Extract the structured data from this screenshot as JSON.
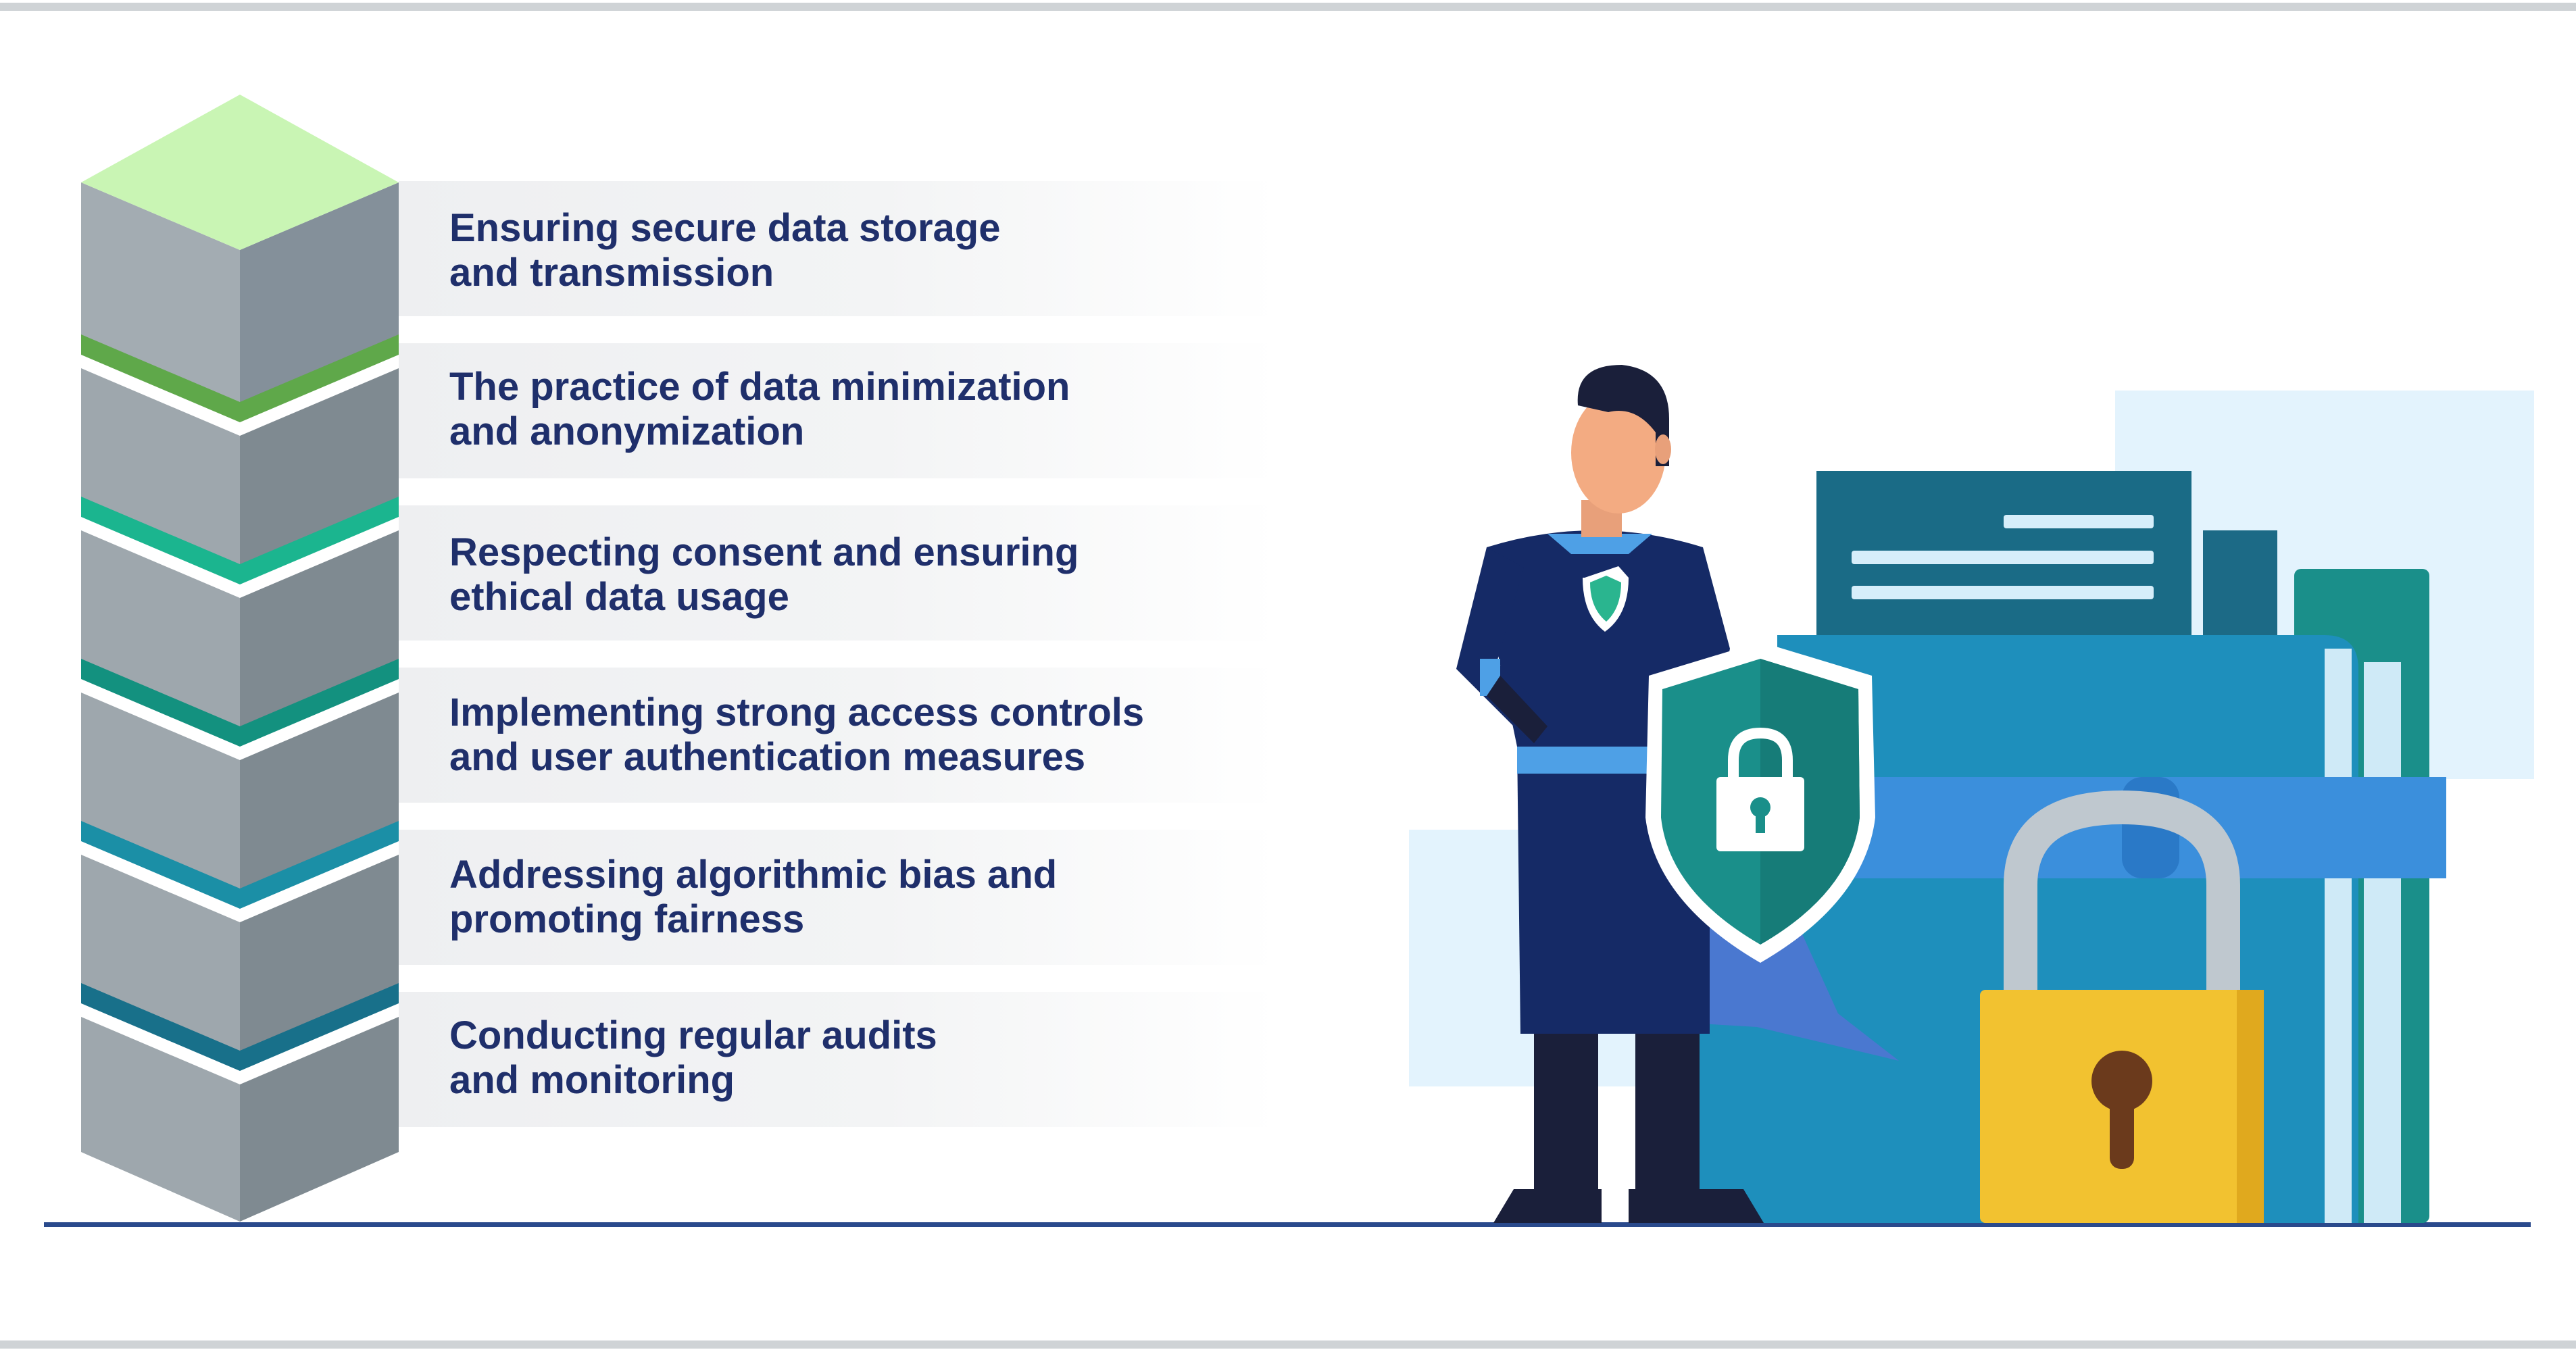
{
  "practices": [
    {
      "line1": "Ensuring secure data storage",
      "line2": "and transmission"
    },
    {
      "line1": "The practice of data minimization",
      "line2": "and anonymization"
    },
    {
      "line1": "Respecting consent and ensuring",
      "line2": "ethical data usage"
    },
    {
      "line1": "Implementing strong access controls",
      "line2": "and user authentication measures"
    },
    {
      "line1": "Addressing algorithmic bias and",
      "line2": "promoting fairness"
    },
    {
      "line1": "Conducting regular audits",
      "line2": "and monitoring"
    }
  ],
  "colors": {
    "text": "#1f2f6b",
    "top_face": "#c9f5b4",
    "divider_1": "#5fa84a",
    "divider_2": "#1bb58f",
    "divider_3": "#13917f",
    "divider_4": "#1b8fa6",
    "divider_5": "#18708a",
    "baseline": "#2a4a8c"
  },
  "icons": {
    "stack": "stacked-cube-tower",
    "hero": "superhero-figure",
    "shield": "shield-lock-icon",
    "folder": "document-folder-icon",
    "padlock": "padlock-icon"
  }
}
